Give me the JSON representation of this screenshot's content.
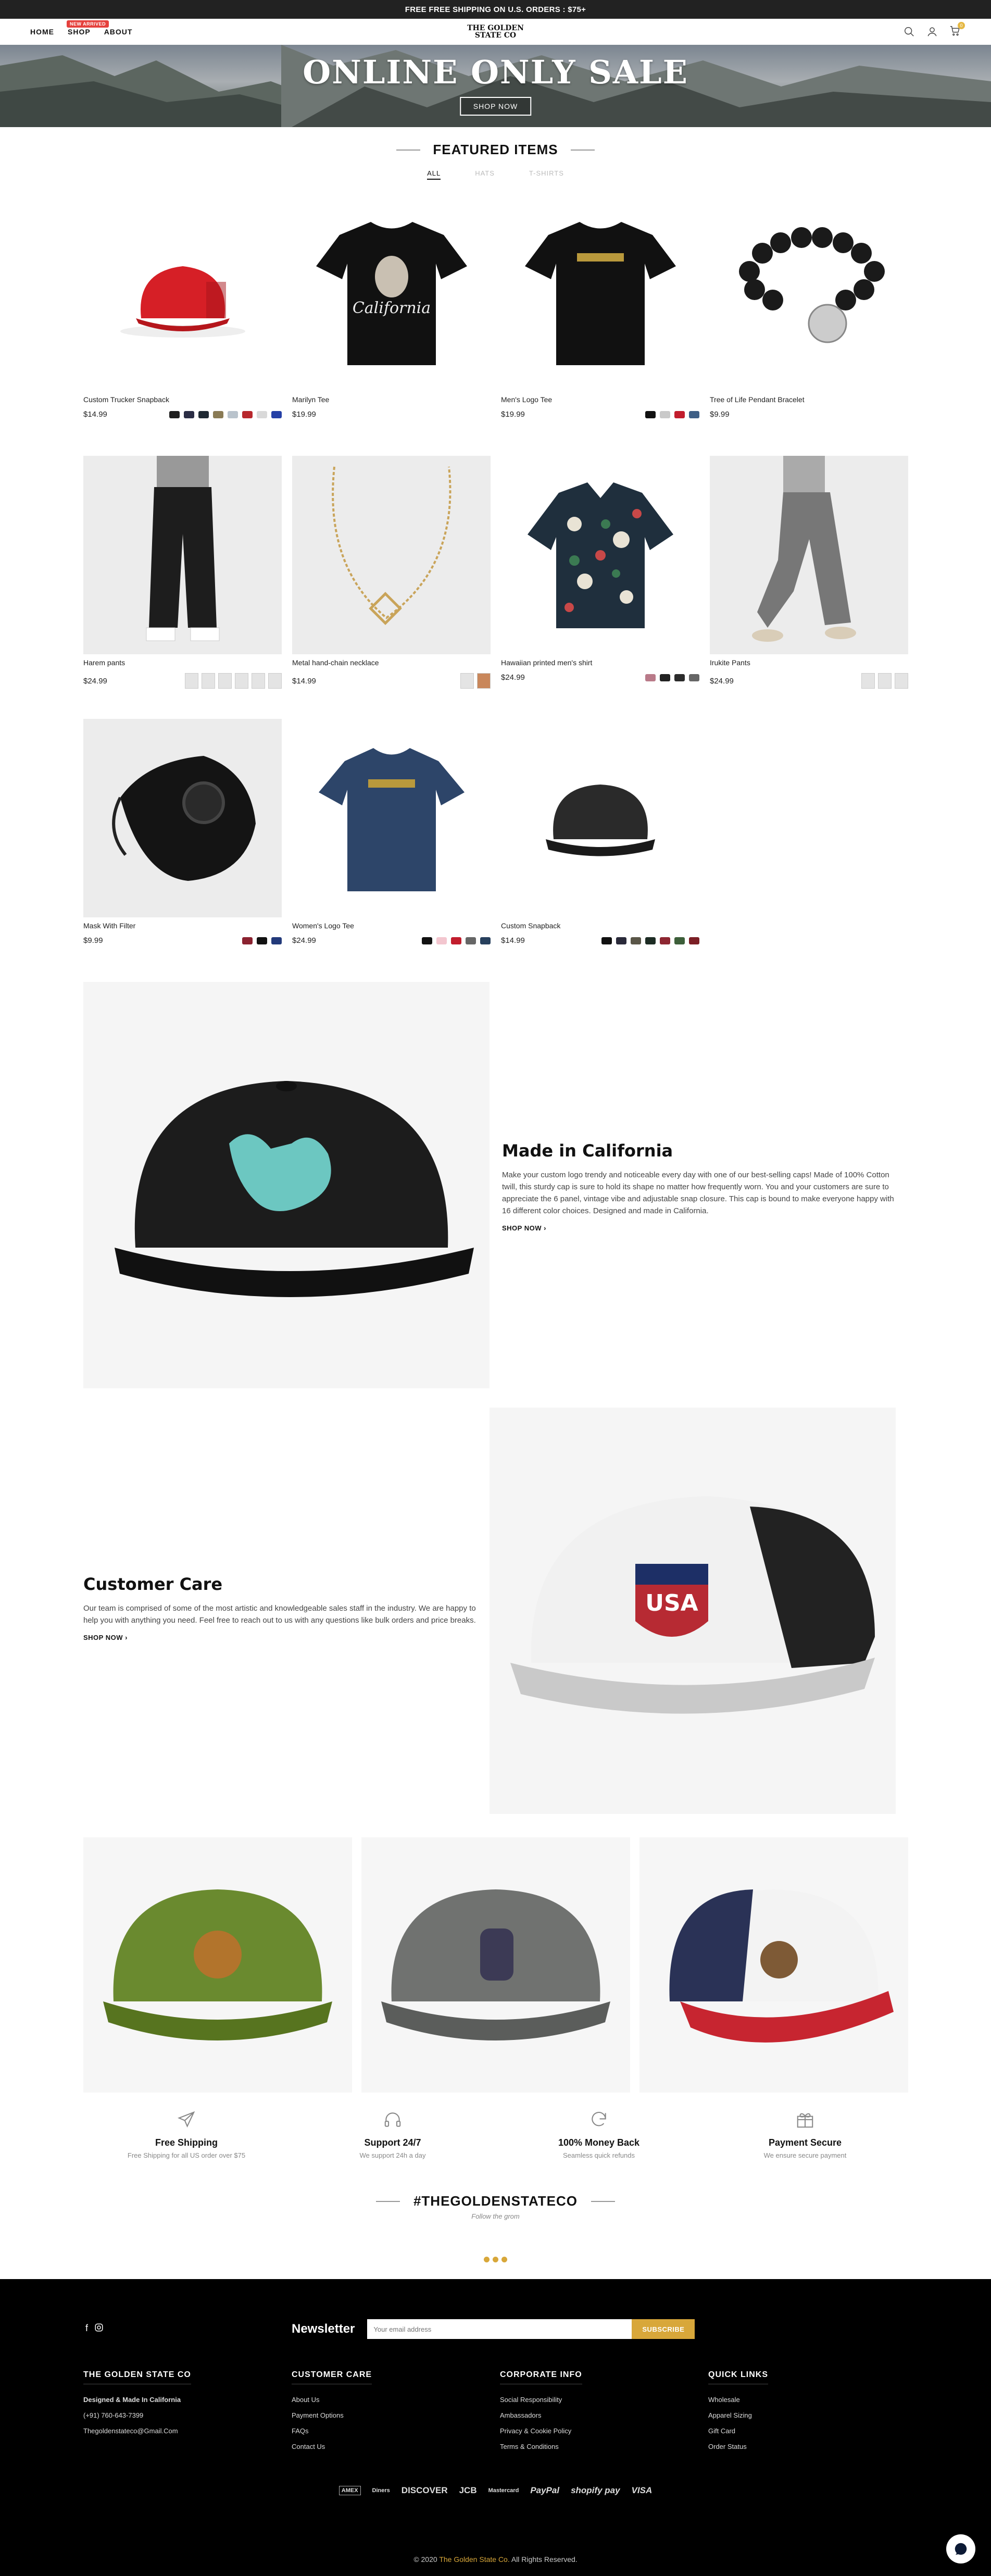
{
  "topbar": {
    "text": "FREE FREE SHIPPING ON U.S. ORDERS : $75+"
  },
  "header": {
    "nav": [
      {
        "label": "HOME"
      },
      {
        "label": "SHOP",
        "badge": "NEW ARRIVED"
      },
      {
        "label": "ABOUT"
      }
    ],
    "logo_line1": "THE GOLDEN",
    "logo_line2": "STATE CO",
    "cart_count": "0"
  },
  "hero": {
    "title": "ONLINE ONLY SALE",
    "button": "SHOP NOW"
  },
  "featured": {
    "title": "FEATURED ITEMS",
    "tabs": [
      "ALL",
      "HATS",
      "T-SHIRTS"
    ],
    "products": [
      {
        "name": "Custom Trucker Snapback",
        "price": "$14.99",
        "swatches": [
          "#1d1d1d",
          "#2b2e45",
          "#1f2933",
          "#8a7b55",
          "#b9c3cc",
          "#b8282d",
          "#d9d9d9",
          "#2540a6"
        ]
      },
      {
        "name": "Marilyn Tee",
        "price": "$19.99",
        "swatches": []
      },
      {
        "name": "Men's Logo Tee",
        "price": "$19.99",
        "swatches": [
          "#111",
          "#c9c9c9",
          "#c21d2d",
          "#3e5f86"
        ]
      },
      {
        "name": "Tree of Life Pendant Bracelet",
        "price": "$9.99",
        "swatches": []
      },
      {
        "name": "Harem pants",
        "price": "$24.99",
        "swatches": []
      },
      {
        "name": "Metal hand-chain necklace",
        "price": "$14.99",
        "swatches": []
      },
      {
        "name": "Hawaiian printed men's shirt",
        "price": "$24.99",
        "swatches": [
          "#b97a89",
          "#222",
          "#2b2b2b",
          "#666"
        ]
      },
      {
        "name": "Irukite Pants",
        "price": "$24.99",
        "swatches": []
      },
      {
        "name": "Mask With Filter",
        "price": "$9.99",
        "swatches": [
          "#8b2230",
          "#111",
          "#233a7a"
        ]
      },
      {
        "name": "Women's Logo Tee",
        "price": "$24.99",
        "swatches": [
          "#111",
          "#f3c6cf",
          "#c21d2d",
          "#666",
          "#27405d"
        ]
      },
      {
        "name": "Custom Snapback",
        "price": "$14.99",
        "swatches": [
          "#111",
          "#2a2a3a",
          "#5a5648",
          "#1d2c24",
          "#8d2631",
          "#3d5f3a",
          "#7b1f25"
        ]
      }
    ]
  },
  "feature1": {
    "title": "Made in California",
    "text": "Make your custom logo trendy and noticeable every day with one of our best-selling caps! Made of 100% Cotton twill, this sturdy cap is sure to hold its shape no matter how frequently worn. You and your customers are sure to appreciate the 6 panel, vintage vibe and adjustable snap closure. This cap is bound to make everyone happy with 16 different color choices. Designed and made in California.",
    "link": "SHOP NOW ›"
  },
  "feature2": {
    "title": "Customer Care",
    "text": "Our team is comprised of some of the most artistic and knowledgeable sales staff in the industry. We are happy to help you with anything you need. Feel free to reach out to us with any questions like bulk orders and price breaks.",
    "link": "SHOP NOW ›"
  },
  "services": [
    {
      "title": "Free Shipping",
      "desc": "Free Shipping for all US order over $75",
      "icon": "plane-icon"
    },
    {
      "title": "Support 24/7",
      "desc": "We support 24h a day",
      "icon": "headset-icon"
    },
    {
      "title": "100% Money Back",
      "desc": "Seamless quick refunds",
      "icon": "refresh-icon"
    },
    {
      "title": "Payment Secure",
      "desc": "We ensure secure payment",
      "icon": "gift-icon"
    }
  ],
  "instagram": {
    "title": "#THEGOLDENSTATECO",
    "subtitle": "Follow the grom"
  },
  "footer": {
    "newsletter_label": "Newsletter",
    "email_placeholder": "Your email address",
    "subscribe": "SUBSCRIBE",
    "col1": {
      "title": "THE GOLDEN STATE CO",
      "lines": [
        "Designed & Made In California",
        "(+91) 760-643-7399",
        "Thegoldenstateco@Gmail.Com"
      ]
    },
    "col2": {
      "title": "CUSTOMER CARE",
      "links": [
        "About Us",
        "Payment Options",
        "FAQs",
        "Contact Us"
      ]
    },
    "col3": {
      "title": "CORPORATE INFO",
      "links": [
        "Social Responsibility",
        "Ambassadors",
        "Privacy & Cookie Policy",
        "Terms & Conditions"
      ]
    },
    "col4": {
      "title": "QUICK LINKS",
      "links": [
        "Wholesale",
        "Apparel Sizing",
        "Gift Card",
        "Order Status"
      ]
    },
    "payments": [
      "AMEX",
      "Diners",
      "DISCOVER",
      "JCB",
      "Mastercard",
      "PayPal",
      "shopify pay",
      "VISA"
    ],
    "copyright_pre": "© 2020",
    "copyright_brand": "The Golden State Co.",
    "copyright_post": "All Rights Reserved."
  }
}
